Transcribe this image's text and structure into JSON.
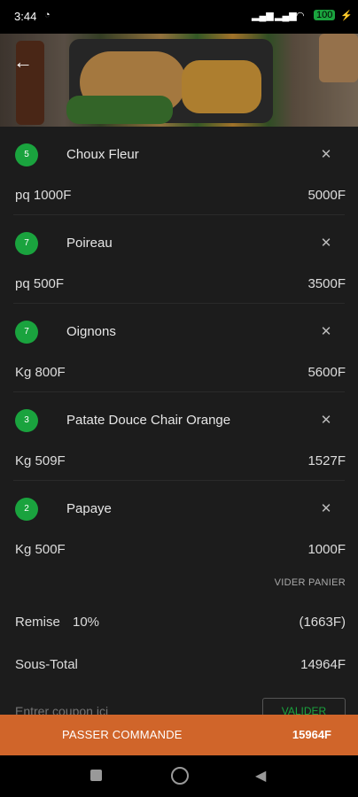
{
  "status_bar": {
    "time": "3:44",
    "battery": "100"
  },
  "cart_items": [
    {
      "qty": "5",
      "name": "Choux Fleur",
      "unit_price": "pq 1000F",
      "total": "5000F"
    },
    {
      "qty": "7",
      "name": "Poireau",
      "unit_price": "pq 500F",
      "total": "3500F"
    },
    {
      "qty": "7",
      "name": "Oignons",
      "unit_price": "Kg 800F",
      "total": "5600F"
    },
    {
      "qty": "3",
      "name": "Patate Douce Chair Orange",
      "unit_price": "Kg 509F",
      "total": "1527F"
    },
    {
      "qty": "2",
      "name": "Papaye",
      "unit_price": "Kg 500F",
      "total": "1000F"
    }
  ],
  "actions": {
    "clear_cart": "VIDER PANIER",
    "validate": "VALIDER"
  },
  "summary": {
    "discount_label": "Remise",
    "discount_pct": "10%",
    "discount_value": "(1663F)",
    "subtotal_label": "Sous-Total",
    "subtotal_value": "14964F"
  },
  "coupon": {
    "placeholder": "Entrer coupon ici"
  },
  "checkout": {
    "label": "PASSER COMMANDE",
    "total": "15964F"
  },
  "colors": {
    "accent_green": "#1aa33e",
    "checkout_orange": "#d0652a",
    "background": "#1c1c1c"
  }
}
